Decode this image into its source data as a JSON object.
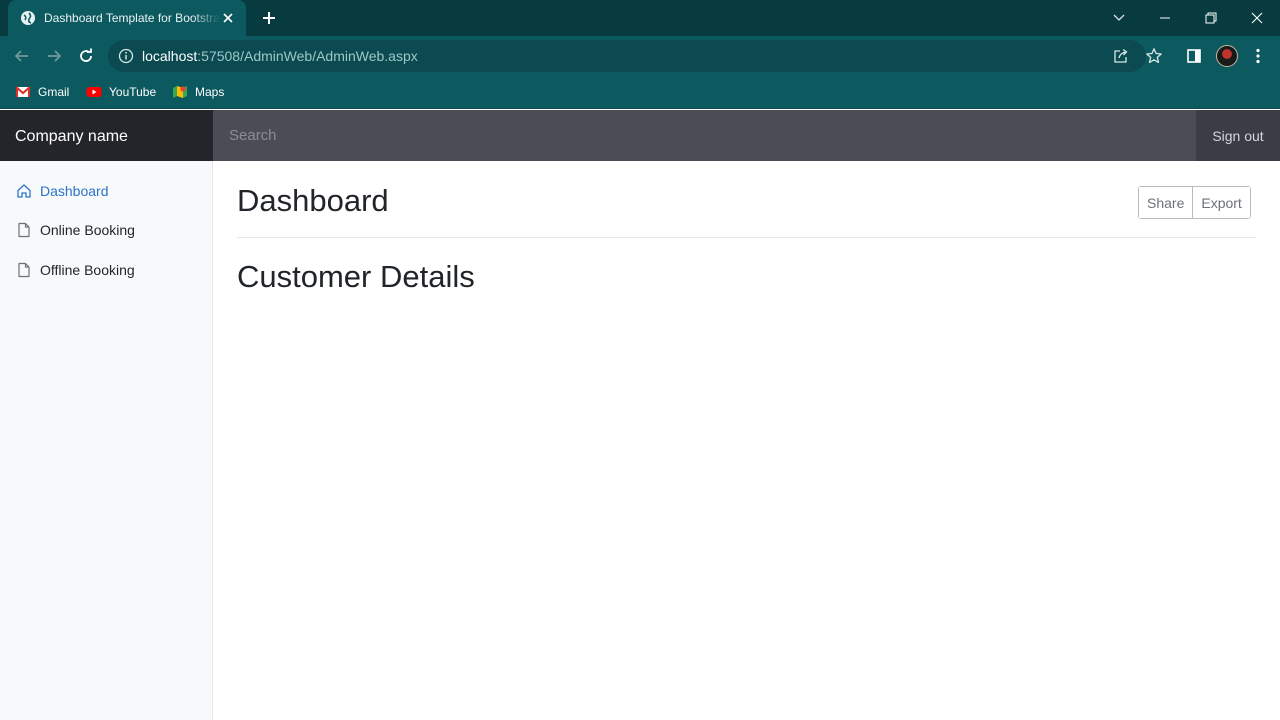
{
  "browser": {
    "tab_title": "Dashboard Template for Bootstrap",
    "url_host": "localhost",
    "url_rest": ":57508/AdminWeb/AdminWeb.aspx",
    "bookmarks": [
      {
        "label": "Gmail",
        "icon": "gmail-icon"
      },
      {
        "label": "YouTube",
        "icon": "youtube-icon"
      },
      {
        "label": "Maps",
        "icon": "maps-icon"
      }
    ]
  },
  "navbar": {
    "brand": "Company name",
    "search_placeholder": "Search",
    "signout_label": "Sign out"
  },
  "sidebar": {
    "items": [
      {
        "label": "Dashboard",
        "icon": "home-icon",
        "active": true
      },
      {
        "label": "Online Booking",
        "icon": "file-icon",
        "active": false
      },
      {
        "label": "Offline Booking",
        "icon": "file-icon",
        "active": false
      }
    ]
  },
  "main": {
    "title": "Dashboard",
    "share_label": "Share",
    "export_label": "Export",
    "section_title": "Customer Details"
  },
  "colors": {
    "browser_frame": "#073b3f",
    "toolbar": "#0c5a60",
    "navbar": "#4a4d56",
    "brand_bg": "#23252a",
    "active_link": "#2c74c6"
  }
}
